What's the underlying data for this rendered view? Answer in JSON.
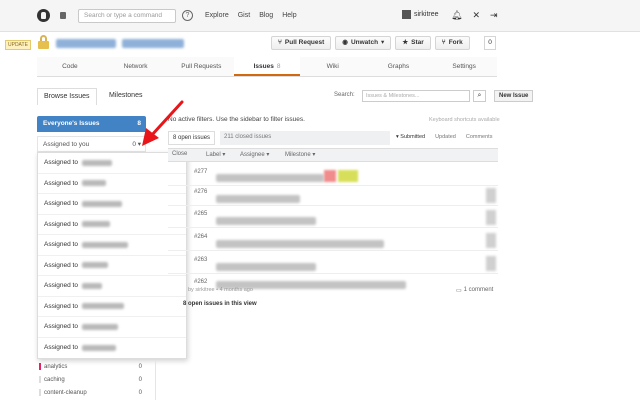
{
  "header": {
    "search_placeholder": "Search or type a command",
    "nav": [
      "Explore",
      "Gist",
      "Blog",
      "Help"
    ],
    "username": "sirkitree"
  },
  "repo": {
    "badge": "UPDATE",
    "buttons": {
      "pull_request": "Pull Request",
      "unwatch": "Unwatch",
      "star": "Star",
      "fork": "Fork"
    },
    "fork_count": "0"
  },
  "tabs": [
    {
      "label": "Code",
      "active": false
    },
    {
      "label": "Network",
      "active": false
    },
    {
      "label": "Pull Requests",
      "active": false
    },
    {
      "label": "Issues",
      "active": true
    },
    {
      "label": "Wiki",
      "active": false
    },
    {
      "label": "Graphs",
      "active": false
    },
    {
      "label": "Settings",
      "active": false
    }
  ],
  "subnav": {
    "browse": "Browse Issues",
    "milestones": "Milestones",
    "search_label": "Search:",
    "search_placeholder": "Issues & Milestones...",
    "new_issue": "New Issue"
  },
  "sidebar": {
    "everyones_issues": "Everyone's Issues",
    "everyones_count": "8",
    "assigned_to_you": "Assigned to you",
    "assigned_count": "0 ▾",
    "dropdown_prefix": "Assigned to",
    "labels": [
      {
        "name": "analytics",
        "count": "0",
        "color": "#e91e63"
      },
      {
        "name": "caching",
        "count": "0",
        "color": "#ffffff"
      },
      {
        "name": "content-cleanup",
        "count": "0",
        "color": "#ffffff"
      }
    ]
  },
  "main": {
    "filters_msg": "No active filters. Use the sidebar to filter issues.",
    "shortcuts": "Keyboard shortcuts available",
    "open_issues": "8 open issues",
    "closed_issues": "211 closed issues",
    "sorts": [
      "Submitted",
      "Updated",
      "Comments"
    ],
    "filterbar": [
      "Close",
      "Label",
      "Assignee",
      "Milestone"
    ],
    "issues": [
      "#277",
      "#276",
      "#265",
      "#264",
      "#263",
      "#262"
    ],
    "comment_count": "1 comment",
    "issue_meta": "by sirkitree • 4 months ago",
    "showing": "8 open issues in this view"
  }
}
